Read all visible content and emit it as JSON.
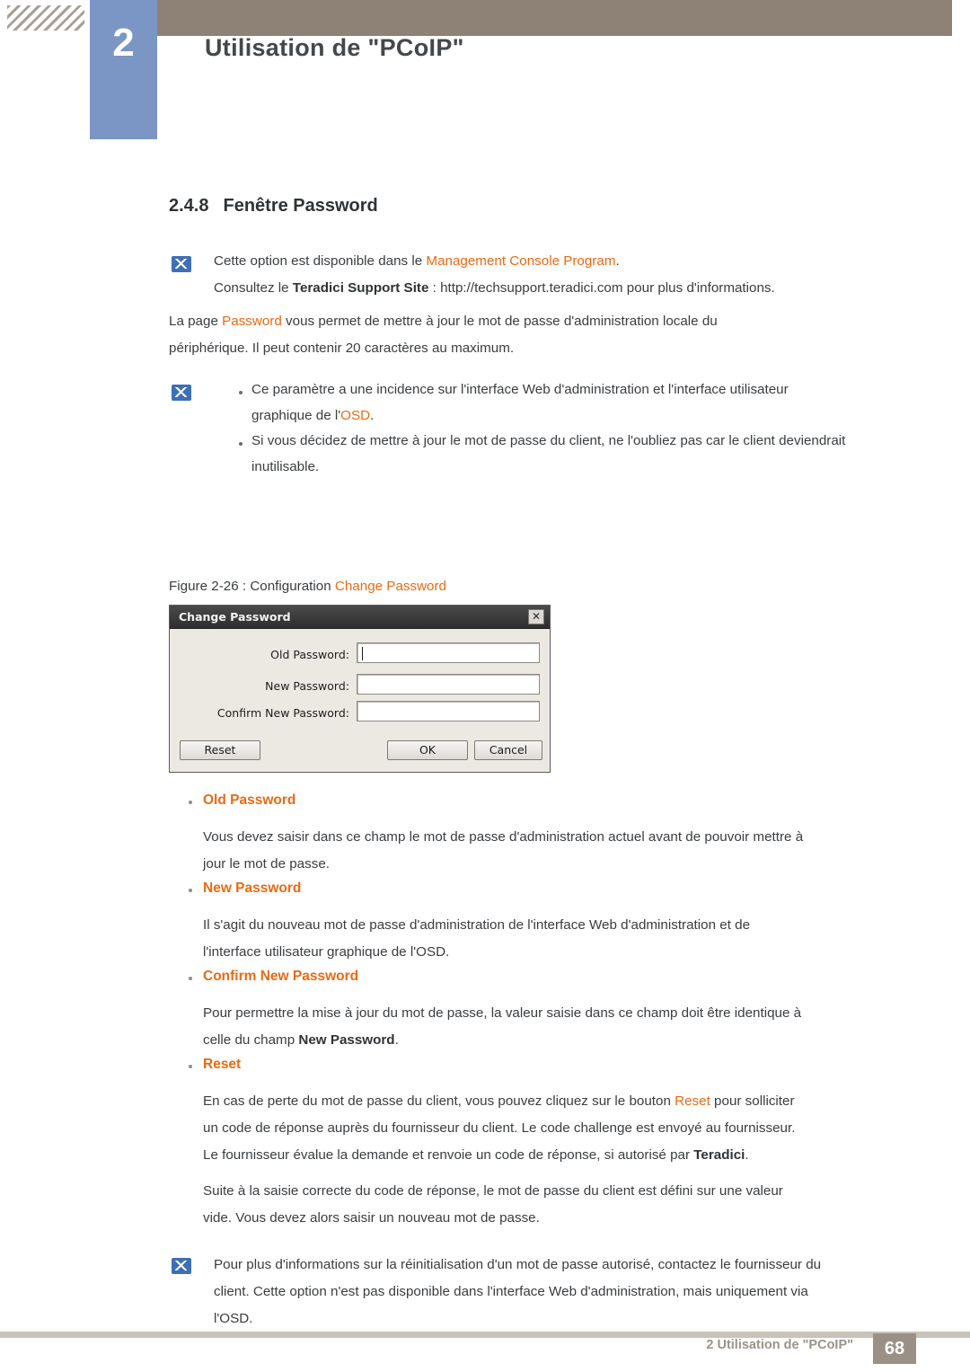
{
  "header": {
    "chapter_number": "2",
    "chapter_title": "Utilisation de \"PCoIP\""
  },
  "section": {
    "number": "2.4.8",
    "title": "Fenêtre Password"
  },
  "notes": {
    "note1_line1_a": "Cette option est disponible dans le ",
    "note1_line1_b": "Management Console Program",
    "note1_line1_c": ".",
    "note1_line2_a": "Consultez le ",
    "note1_line2_b": "Teradici Support Site",
    "note1_line2_c": " : http://techsupport.teradici.com pour plus d'informations.",
    "note2_b1_line1": "Ce paramètre a une incidence sur l'interface Web d'administration et l'interface utilisateur",
    "note2_b1_line2_a": "graphique de l'",
    "note2_b1_line2_b": "OSD",
    "note2_b1_line2_c": ".",
    "note2_b2_line1": "Si vous décidez de mettre à jour le mot de passe du client, ne l'oubliez pas car le client deviendrait",
    "note2_b2_line2": "inutilisable.",
    "note3_line1": "Pour plus d'informations sur la réinitialisation d'un mot de passe autorisé, contactez le fournisseur du",
    "note3_line2": "client. Cette option n'est pas disponible dans l'interface Web d'administration, mais uniquement via",
    "note3_line3": "l'OSD."
  },
  "intro": {
    "line1_a": "La page ",
    "line1_b": "Password",
    "line1_c": " vous permet de mettre à jour le mot de passe d'administration locale du",
    "line2": "périphérique. Il peut contenir 20 caractères au maximum."
  },
  "figure": {
    "caption_a": "Figure 2-26 : Configuration ",
    "caption_b": "Change Password"
  },
  "dialog": {
    "title": "Change Password",
    "close_label": "✕",
    "fields": [
      {
        "label": "Old Password:",
        "value": ""
      },
      {
        "label": "New Password:",
        "value": ""
      },
      {
        "label": "Confirm New Password:",
        "value": ""
      }
    ],
    "buttons": {
      "reset": "Reset",
      "ok": "OK",
      "cancel": "Cancel"
    }
  },
  "items": [
    {
      "heading": "Old Password",
      "lines": [
        "Vous devez saisir dans ce champ le mot de passe d'administration actuel avant de pouvoir mettre à",
        "jour le mot de passe."
      ]
    },
    {
      "heading": "New Password",
      "lines": [
        "Il s'agit du nouveau mot de passe d'administration de l'interface Web d'administration et de",
        "l'interface utilisateur graphique de l'OSD."
      ]
    },
    {
      "heading": "Confirm New Password",
      "lines": [
        "Pour permettre la mise à jour du mot de passe, la valeur saisie dans ce champ doit être identique à",
        "celle du champ "
      ],
      "line2_bold": "New Password",
      "line2_tail": "."
    },
    {
      "heading": "Reset",
      "lines": [
        "En cas de perte du mot de passe du client, vous pouvez cliquez sur le bouton ",
        " pour solliciter",
        "un code de réponse auprès du fournisseur du client. Le code challenge est envoyé au fournisseur.",
        "Le fournisseur évalue la demande et renvoie un code de réponse, si autorisé par ",
        ".",
        "Suite à la saisie correcte du code de réponse, le mot de passe du client est défini sur une valeur",
        "vide. Vous devez alors saisir un nouveau mot de passe."
      ],
      "inline_reset": "Reset",
      "inline_teradici": "Teradici"
    }
  ],
  "footer": {
    "text": "2 Utilisation de \"PCoIP\"",
    "page_number": "68"
  },
  "colors": {
    "header_bar": "#8d8275",
    "chapter_box": "#7b96c4",
    "accent_orange": "#e96a13",
    "note_icon": "#3f6fb5",
    "footer": "#9a9086"
  }
}
